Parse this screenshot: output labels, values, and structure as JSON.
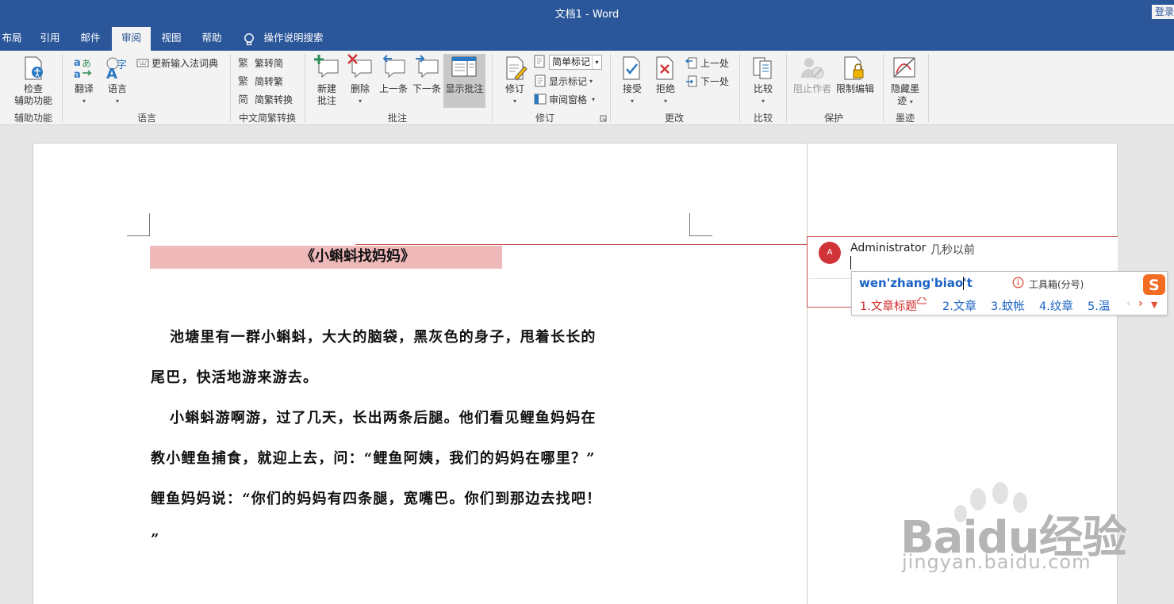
{
  "window": {
    "title": "文档1  -  Word",
    "login_label": "登录"
  },
  "tabs": [
    {
      "label": "布局",
      "active": false
    },
    {
      "label": "引用",
      "active": false
    },
    {
      "label": "邮件",
      "active": false
    },
    {
      "label": "审阅",
      "active": true
    },
    {
      "label": "视图",
      "active": false
    },
    {
      "label": "帮助",
      "active": false
    }
  ],
  "search": {
    "label": "操作说明搜索"
  },
  "ribbon": {
    "accessibility": {
      "button_line1": "检查",
      "button_line2": "辅助功能",
      "group": "辅助功能"
    },
    "language": {
      "translate": "翻译",
      "language": "语言",
      "update_ime": "更新输入法词典",
      "group": "语言"
    },
    "chinese": {
      "to_simplified": "繁转简",
      "to_traditional": "简转繁",
      "convert": "简繁转换",
      "group": "中文简繁转换"
    },
    "comments": {
      "new_line1": "新建",
      "new_line2": "批注",
      "delete": "删除",
      "previous": "上一条",
      "next": "下一条",
      "show": "显示批注",
      "group": "批注"
    },
    "tracking": {
      "track": "修订",
      "markup_mode": "简单标记",
      "show_markup": "显示标记",
      "reviewing_pane": "审阅窗格",
      "group": "修订"
    },
    "changes": {
      "accept": "接受",
      "reject": "拒绝",
      "previous": "上一处",
      "next": "下一处",
      "group": "更改"
    },
    "compare": {
      "compare": "比较",
      "group": "比较"
    },
    "protect": {
      "block_authors": "阻止作者",
      "restrict_editing": "限制编辑",
      "group": "保护"
    },
    "ink": {
      "hide_ink_line1": "隐藏墨",
      "hide_ink_line2": "迹",
      "group": "墨迹"
    }
  },
  "document": {
    "title": "《小蝌蚪找妈妈》",
    "lines": [
      "池塘里有一群小蝌蚪，大大的脑袋，黑灰色的身子，甩着长长的",
      "尾巴，快活地游来游去。",
      "小蝌蚪游啊游，过了几天，长出两条后腿。他们看见鲤鱼妈妈在",
      "教小鲤鱼捕食，就迎上去，问：“鲤鱼阿姨，我们的妈妈在哪里？”",
      "鲤鱼妈妈说：“你们的妈妈有四条腿，宽嘴巴。你们到那边去找吧！",
      "”"
    ]
  },
  "comment": {
    "avatar_letter": "A",
    "author": "Administrator",
    "time": "几秒以前"
  },
  "ime": {
    "pinyin": "wen'zhang'biao't",
    "toolbox": "工具箱(分号)",
    "candidates": [
      "1.文章标题",
      "2.文章",
      "3.蚊帐",
      "4.纹章",
      "5.温"
    ]
  },
  "watermark": {
    "brand": "Baidu经验",
    "url": "jingyan.baidu.com"
  },
  "colors": {
    "titlebar": "#2b579a",
    "comment_border": "#c0504d",
    "title_highlight": "#efb8b9",
    "ime_blue": "#1b63c6",
    "ime_red": "#d12b2b"
  }
}
